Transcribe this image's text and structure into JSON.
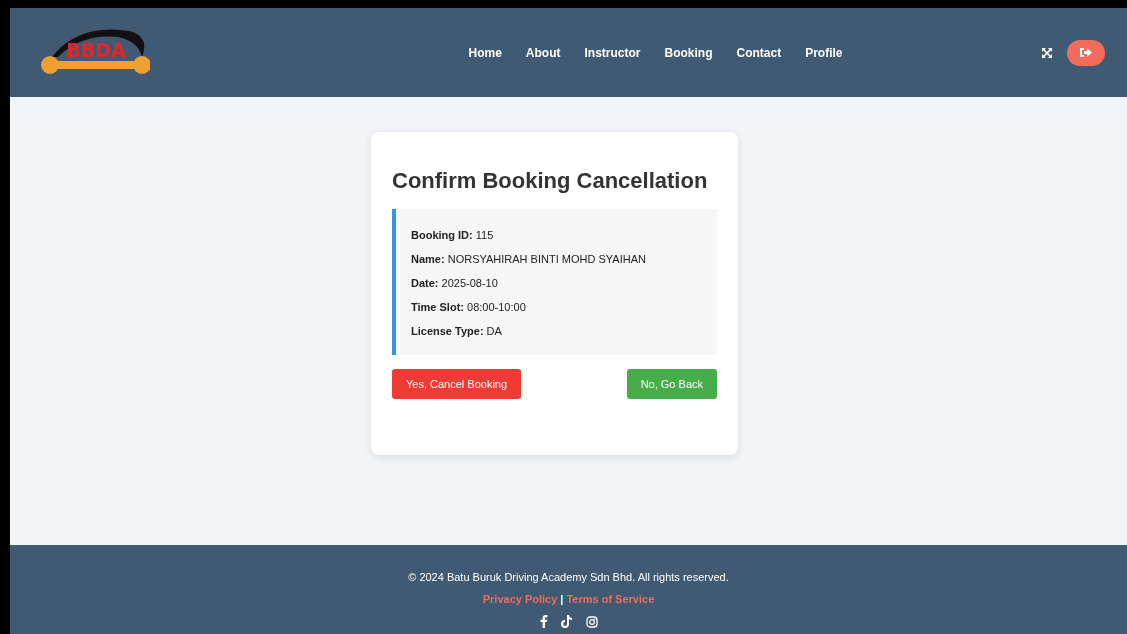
{
  "header": {
    "logo_text": "BBDA",
    "nav": [
      {
        "label": "Home"
      },
      {
        "label": "About"
      },
      {
        "label": "Instructor"
      },
      {
        "label": "Booking"
      },
      {
        "label": "Contact"
      },
      {
        "label": "Profile"
      }
    ]
  },
  "card": {
    "title": "Confirm Booking Cancellation",
    "details": [
      {
        "label": "Booking ID:",
        "value": "115"
      },
      {
        "label": "Name:",
        "value": "NORSYAHIRAH BINTI MOHD SYAIHAN"
      },
      {
        "label": "Date:",
        "value": "2025-08-10"
      },
      {
        "label": "Time Slot:",
        "value": "08:00-10:00"
      },
      {
        "label": "License Type:",
        "value": "DA"
      }
    ],
    "buttons": [
      {
        "label": "Yes, Cancel Booking",
        "kind": "danger"
      },
      {
        "label": "No, Go Back",
        "kind": "success"
      }
    ]
  },
  "footer": {
    "copyright": "© 2024 Batu Buruk Driving Academy Sdn Bhd. All rights reserved.",
    "links": [
      {
        "label": "Privacy Policy"
      },
      {
        "label": "Terms of Service"
      }
    ],
    "separator": "|"
  }
}
